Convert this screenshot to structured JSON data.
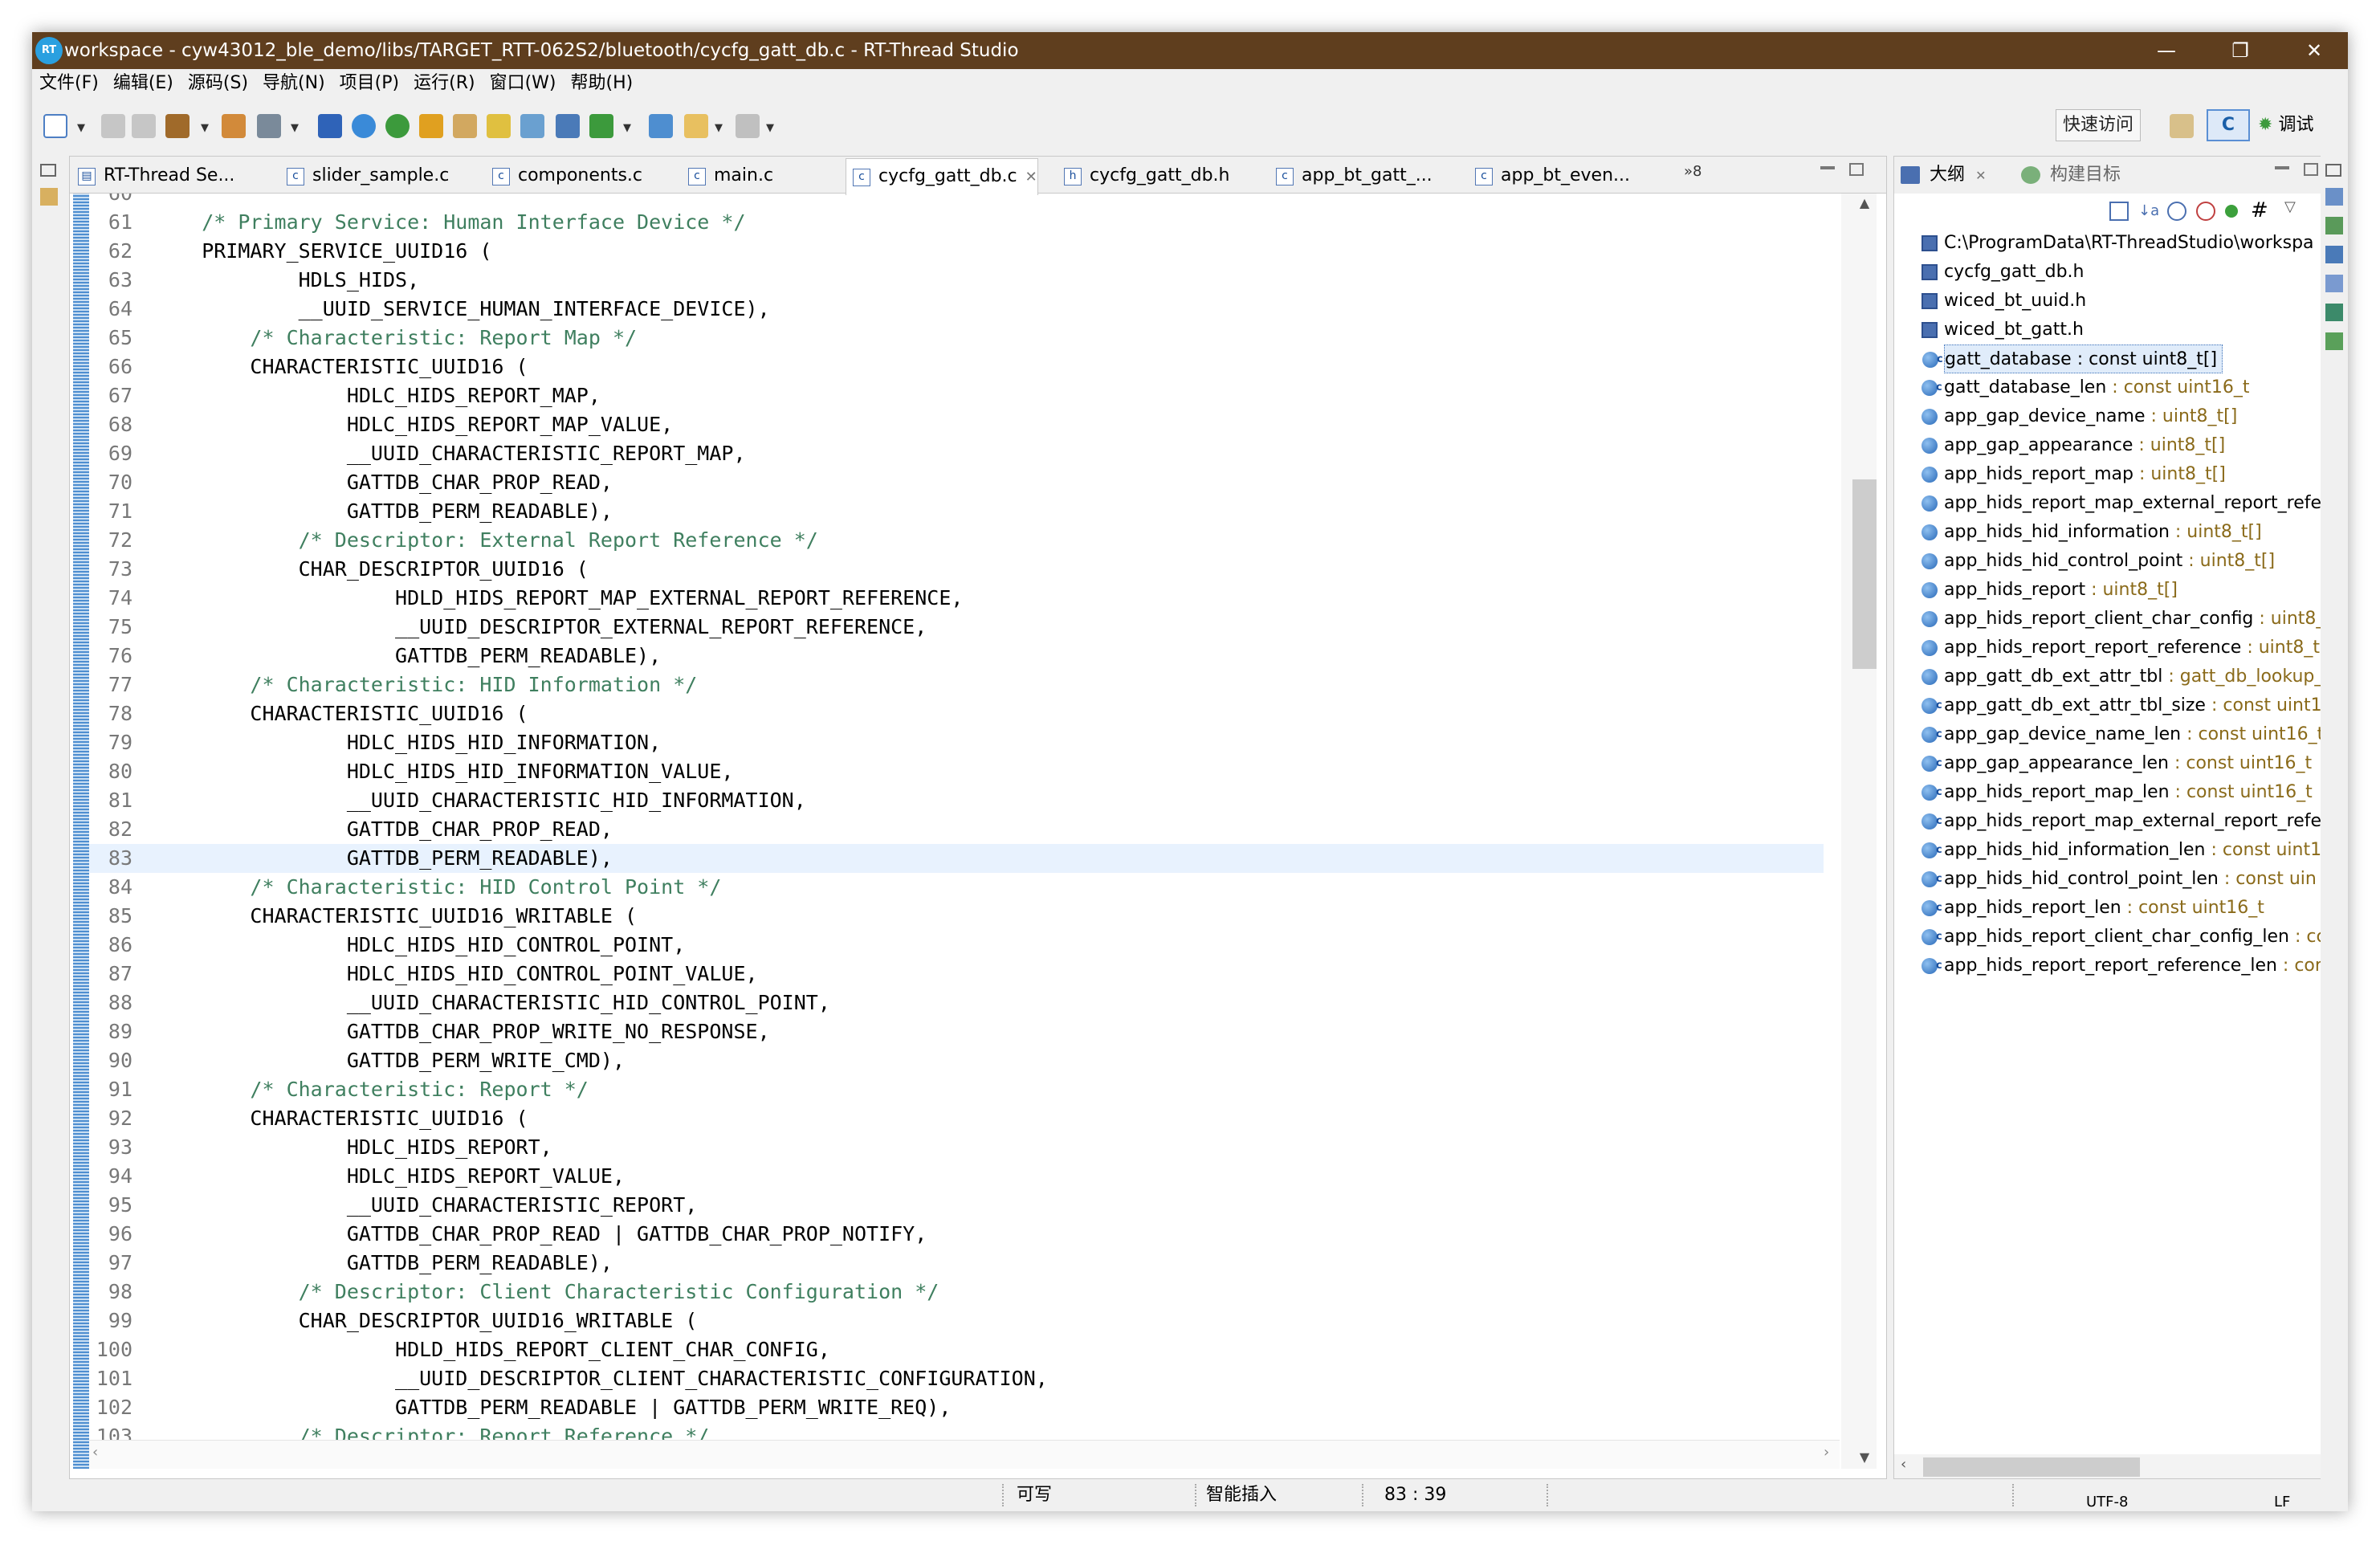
{
  "window": {
    "title": "workspace - cyw43012_ble_demo/libs/TARGET_RTT-062S2/bluetooth/cycfg_gatt_db.c - RT-Thread Studio",
    "logo_text": "RT",
    "controls": {
      "minimize": "—",
      "maximize": "❐",
      "close": "✕"
    }
  },
  "menu": [
    "文件(F)",
    "编辑(E)",
    "源码(S)",
    "导航(N)",
    "项目(P)",
    "运行(R)",
    "窗口(W)",
    "帮助(H)"
  ],
  "toolbar": {
    "quick_access": "快速访问",
    "perspective_c": "C",
    "perspective_debug": "调试"
  },
  "editor": {
    "tabs": [
      {
        "label": "RT-Thread Se...",
        "icon": "rt-thread-settings-icon",
        "active": false
      },
      {
        "label": "slider_sample.c",
        "icon": "c-file-icon",
        "active": false
      },
      {
        "label": "components.c",
        "icon": "c-file-icon",
        "active": false
      },
      {
        "label": "main.c",
        "icon": "c-file-icon",
        "active": false
      },
      {
        "label": "cycfg_gatt_db.c",
        "icon": "c-file-icon",
        "active": true
      },
      {
        "label": "cycfg_gatt_db.h",
        "icon": "h-file-icon",
        "active": false
      },
      {
        "label": "app_bt_gatt_...",
        "icon": "c-file-icon",
        "active": false
      },
      {
        "label": "app_bt_even...",
        "icon": "c-file-icon",
        "active": false
      }
    ],
    "overflow_count": "»8",
    "highlighted_line": "83",
    "lines": [
      {
        "n": "60",
        "code": "",
        "c": false
      },
      {
        "n": "61",
        "code": "    /* Primary Service: Human Interface Device */",
        "c": true
      },
      {
        "n": "62",
        "code": "    PRIMARY_SERVICE_UUID16 (",
        "c": false
      },
      {
        "n": "63",
        "code": "            HDLS_HIDS,",
        "c": false
      },
      {
        "n": "64",
        "code": "            __UUID_SERVICE_HUMAN_INTERFACE_DEVICE),",
        "c": false
      },
      {
        "n": "65",
        "code": "        /* Characteristic: Report Map */",
        "c": true
      },
      {
        "n": "66",
        "code": "        CHARACTERISTIC_UUID16 (",
        "c": false
      },
      {
        "n": "67",
        "code": "                HDLC_HIDS_REPORT_MAP,",
        "c": false
      },
      {
        "n": "68",
        "code": "                HDLC_HIDS_REPORT_MAP_VALUE,",
        "c": false
      },
      {
        "n": "69",
        "code": "                __UUID_CHARACTERISTIC_REPORT_MAP,",
        "c": false
      },
      {
        "n": "70",
        "code": "                GATTDB_CHAR_PROP_READ,",
        "c": false
      },
      {
        "n": "71",
        "code": "                GATTDB_PERM_READABLE),",
        "c": false
      },
      {
        "n": "72",
        "code": "            /* Descriptor: External Report Reference */",
        "c": true
      },
      {
        "n": "73",
        "code": "            CHAR_DESCRIPTOR_UUID16 (",
        "c": false
      },
      {
        "n": "74",
        "code": "                    HDLD_HIDS_REPORT_MAP_EXTERNAL_REPORT_REFERENCE,",
        "c": false
      },
      {
        "n": "75",
        "code": "                    __UUID_DESCRIPTOR_EXTERNAL_REPORT_REFERENCE,",
        "c": false
      },
      {
        "n": "76",
        "code": "                    GATTDB_PERM_READABLE),",
        "c": false
      },
      {
        "n": "77",
        "code": "        /* Characteristic: HID Information */",
        "c": true
      },
      {
        "n": "78",
        "code": "        CHARACTERISTIC_UUID16 (",
        "c": false
      },
      {
        "n": "79",
        "code": "                HDLC_HIDS_HID_INFORMATION,",
        "c": false
      },
      {
        "n": "80",
        "code": "                HDLC_HIDS_HID_INFORMATION_VALUE,",
        "c": false
      },
      {
        "n": "81",
        "code": "                __UUID_CHARACTERISTIC_HID_INFORMATION,",
        "c": false
      },
      {
        "n": "82",
        "code": "                GATTDB_CHAR_PROP_READ,",
        "c": false
      },
      {
        "n": "83",
        "code": "                GATTDB_PERM_READABLE),",
        "c": false
      },
      {
        "n": "84",
        "code": "        /* Characteristic: HID Control Point */",
        "c": true
      },
      {
        "n": "85",
        "code": "        CHARACTERISTIC_UUID16_WRITABLE (",
        "c": false
      },
      {
        "n": "86",
        "code": "                HDLC_HIDS_HID_CONTROL_POINT,",
        "c": false
      },
      {
        "n": "87",
        "code": "                HDLC_HIDS_HID_CONTROL_POINT_VALUE,",
        "c": false
      },
      {
        "n": "88",
        "code": "                __UUID_CHARACTERISTIC_HID_CONTROL_POINT,",
        "c": false
      },
      {
        "n": "89",
        "code": "                GATTDB_CHAR_PROP_WRITE_NO_RESPONSE,",
        "c": false
      },
      {
        "n": "90",
        "code": "                GATTDB_PERM_WRITE_CMD),",
        "c": false
      },
      {
        "n": "91",
        "code": "        /* Characteristic: Report */",
        "c": true
      },
      {
        "n": "92",
        "code": "        CHARACTERISTIC_UUID16 (",
        "c": false
      },
      {
        "n": "93",
        "code": "                HDLC_HIDS_REPORT,",
        "c": false
      },
      {
        "n": "94",
        "code": "                HDLC_HIDS_REPORT_VALUE,",
        "c": false
      },
      {
        "n": "95",
        "code": "                __UUID_CHARACTERISTIC_REPORT,",
        "c": false
      },
      {
        "n": "96",
        "code": "                GATTDB_CHAR_PROP_READ | GATTDB_CHAR_PROP_NOTIFY,",
        "c": false
      },
      {
        "n": "97",
        "code": "                GATTDB_PERM_READABLE),",
        "c": false
      },
      {
        "n": "98",
        "code": "            /* Descriptor: Client Characteristic Configuration */",
        "c": true
      },
      {
        "n": "99",
        "code": "            CHAR_DESCRIPTOR_UUID16_WRITABLE (",
        "c": false
      },
      {
        "n": "100",
        "code": "                    HDLD_HIDS_REPORT_CLIENT_CHAR_CONFIG,",
        "c": false
      },
      {
        "n": "101",
        "code": "                    __UUID_DESCRIPTOR_CLIENT_CHARACTERISTIC_CONFIGURATION,",
        "c": false
      },
      {
        "n": "102",
        "code": "                    GATTDB_PERM_READABLE | GATTDB_PERM_WRITE_REQ),",
        "c": false
      },
      {
        "n": "103",
        "code": "            /* Descriptor: Report Reference */",
        "c": true
      }
    ]
  },
  "outline": {
    "tabs": [
      {
        "label": "大纲",
        "icon": "outline-icon",
        "active": true
      },
      {
        "label": "构建目标",
        "icon": "build-targets-icon",
        "active": false
      }
    ],
    "items": [
      {
        "kind": "hdr",
        "name": "C:\\ProgramData\\RT-ThreadStudio\\workspa",
        "type": "",
        "sel": false
      },
      {
        "kind": "hdr",
        "name": "cycfg_gatt_db.h",
        "type": "",
        "sel": false
      },
      {
        "kind": "hdr",
        "name": "wiced_bt_uuid.h",
        "type": "",
        "sel": false
      },
      {
        "kind": "hdr",
        "name": "wiced_bt_gatt.h",
        "type": "",
        "sel": false
      },
      {
        "kind": "cvar",
        "name": "gatt_database",
        "type": " : const uint8_t[]",
        "sel": true
      },
      {
        "kind": "cvar",
        "name": "gatt_database_len",
        "type": " : const uint16_t",
        "sel": false
      },
      {
        "kind": "var",
        "name": "app_gap_device_name",
        "type": " : uint8_t[]",
        "sel": false
      },
      {
        "kind": "var",
        "name": "app_gap_appearance",
        "type": " : uint8_t[]",
        "sel": false
      },
      {
        "kind": "var",
        "name": "app_hids_report_map",
        "type": " : uint8_t[]",
        "sel": false
      },
      {
        "kind": "var",
        "name": "app_hids_report_map_external_report_refe",
        "type": "",
        "sel": false
      },
      {
        "kind": "var",
        "name": "app_hids_hid_information",
        "type": " : uint8_t[]",
        "sel": false
      },
      {
        "kind": "var",
        "name": "app_hids_hid_control_point",
        "type": " : uint8_t[]",
        "sel": false
      },
      {
        "kind": "var",
        "name": "app_hids_report",
        "type": " : uint8_t[]",
        "sel": false
      },
      {
        "kind": "var",
        "name": "app_hids_report_client_char_config",
        "type": " : uint8_",
        "sel": false
      },
      {
        "kind": "var",
        "name": "app_hids_report_report_reference",
        "type": " : uint8_t",
        "sel": false
      },
      {
        "kind": "var",
        "name": "app_gatt_db_ext_attr_tbl",
        "type": " : gatt_db_lookup_",
        "sel": false
      },
      {
        "kind": "cvar",
        "name": "app_gatt_db_ext_attr_tbl_size",
        "type": " : const uint16",
        "sel": false
      },
      {
        "kind": "cvar",
        "name": "app_gap_device_name_len",
        "type": " : const uint16_t",
        "sel": false
      },
      {
        "kind": "cvar",
        "name": "app_gap_appearance_len",
        "type": " : const uint16_t",
        "sel": false
      },
      {
        "kind": "cvar",
        "name": "app_hids_report_map_len",
        "type": " : const uint16_t",
        "sel": false
      },
      {
        "kind": "cvar",
        "name": "app_hids_report_map_external_report_refe",
        "type": "",
        "sel": false
      },
      {
        "kind": "cvar",
        "name": "app_hids_hid_information_len",
        "type": " : const uint1",
        "sel": false
      },
      {
        "kind": "cvar",
        "name": "app_hids_hid_control_point_len",
        "type": " : const uin",
        "sel": false
      },
      {
        "kind": "cvar",
        "name": "app_hids_report_len",
        "type": " : const uint16_t",
        "sel": false
      },
      {
        "kind": "cvar",
        "name": "app_hids_report_client_char_config_len",
        "type": " : cc",
        "sel": false
      },
      {
        "kind": "cvar",
        "name": "app_hids_report_report_reference_len",
        "type": " : cor",
        "sel": false
      }
    ]
  },
  "status": {
    "writable": "可写",
    "insert_mode": "智能插入",
    "cursor": "83 : 39",
    "encoding": "UTF-8",
    "line_ending": "LF"
  },
  "colors": {
    "titlebar": "#5f3e1e",
    "comment": "#3f7f5f",
    "current_line": "#e8f2fe",
    "type_hint": "#8a6a1a"
  }
}
